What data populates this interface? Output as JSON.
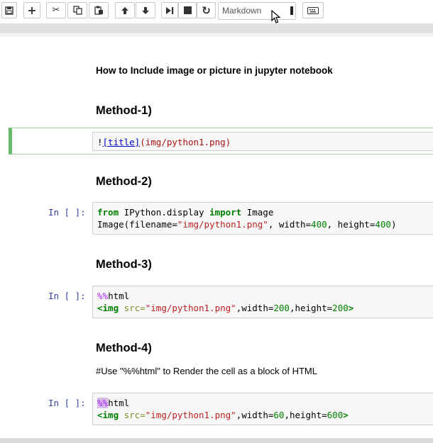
{
  "toolbar": {
    "buttons": [
      {
        "name": "save-button",
        "icon": "save-icon"
      },
      {
        "name": "insert-cell-button",
        "icon": "plus-icon",
        "glyph": "+"
      },
      {
        "name": "cut-button",
        "icon": "scissors-icon",
        "glyph": "✂"
      },
      {
        "name": "copy-button",
        "icon": "copy-icon"
      },
      {
        "name": "paste-button",
        "icon": "paste-icon"
      },
      {
        "name": "move-up-button",
        "icon": "arrow-up-icon",
        "glyph": "🡑"
      },
      {
        "name": "move-down-button",
        "icon": "arrow-down-icon",
        "glyph": "🡓"
      },
      {
        "name": "run-button",
        "icon": "step-forward-icon"
      },
      {
        "name": "interrupt-button",
        "icon": "stop-icon"
      },
      {
        "name": "restart-button",
        "icon": "refresh-icon",
        "glyph": "↻"
      },
      {
        "name": "keyboard-button",
        "icon": "keyboard-icon"
      }
    ],
    "cell_type_select": "Markdown"
  },
  "notebook": {
    "subtitle": "How to Include image or picture in jupyter notebook",
    "method1": {
      "heading": "Method-1)",
      "code": {
        "bang": "!",
        "link": "[title]",
        "url": "(img/python1.png)"
      }
    },
    "method2": {
      "heading": "Method-2)",
      "prompt": "In [ ]:",
      "line1": {
        "kw_from": "from",
        "module": " IPython.display ",
        "kw_import": "import",
        "name": " Image"
      },
      "line2": {
        "call": "Image(filename=",
        "str": "\"img/python1.png\"",
        "mid1": ", width=",
        "w": "400",
        "mid2": ", height=",
        "h": "400",
        "end": ")"
      }
    },
    "method3": {
      "heading": "Method-3)",
      "prompt": "In [ ]:",
      "magic": {
        "pct": "%%",
        "word": "html"
      },
      "line2": {
        "tag_open": "<img",
        "attr": " src=",
        "str": "\"img/python1.png\"",
        "mid1": ",width=",
        "w": "200",
        "mid2": ",height=",
        "h": "200",
        "tag_close": ">"
      }
    },
    "method4": {
      "heading": "Method-4)",
      "note": "#Use \"%%html\" to Render the cell as a block of HTML",
      "prompt": "In [ ]:",
      "magic": {
        "pct": "%%",
        "word": "html"
      },
      "line2": {
        "tag_open": "<img",
        "attr": " src=",
        "str": "\"img/python1.png\"",
        "mid1": ",width=",
        "w": "60",
        "mid2": ",height=",
        "h": "600",
        "tag_close": ">"
      }
    }
  }
}
